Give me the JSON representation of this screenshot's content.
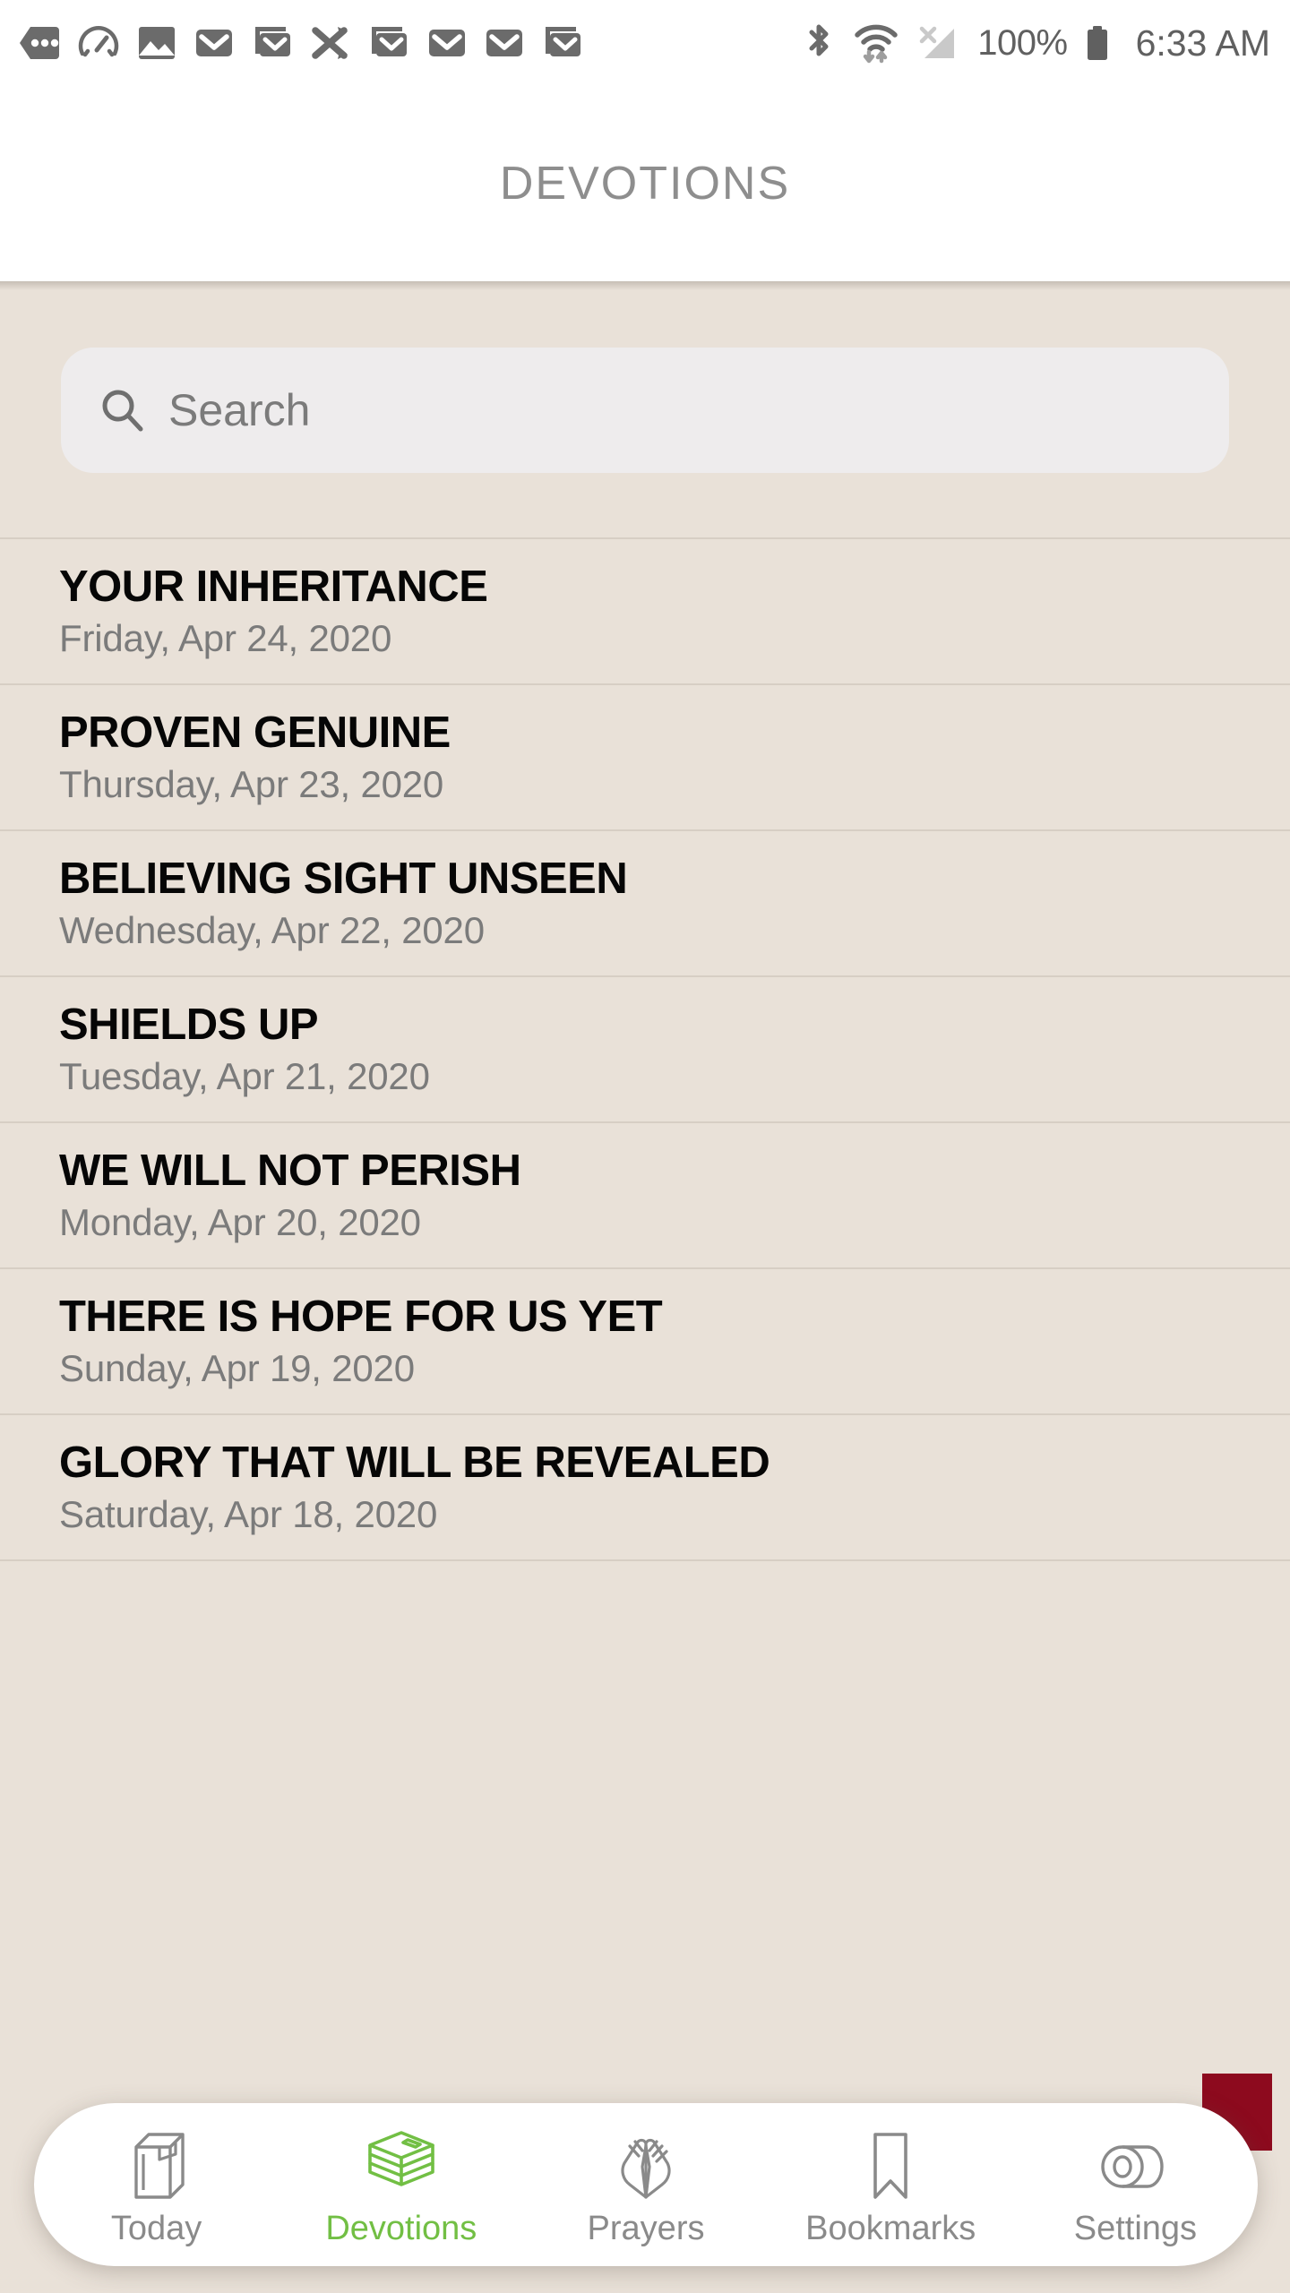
{
  "statusbar": {
    "left_icons": [
      {
        "name": "more-notifications-icon",
        "glyph": "•••"
      },
      {
        "name": "speedometer-icon"
      },
      {
        "name": "image-icon"
      },
      {
        "name": "mail-icon"
      },
      {
        "name": "mail-stack-icon"
      },
      {
        "name": "shuffle-icon"
      },
      {
        "name": "mail-stack-icon"
      },
      {
        "name": "mail-icon"
      },
      {
        "name": "mail-icon"
      },
      {
        "name": "mail-stack-icon"
      }
    ],
    "right_icons": [
      {
        "name": "bluetooth-icon"
      },
      {
        "name": "wifi-icon"
      },
      {
        "name": "cellular-no-signal-icon"
      }
    ],
    "battery_percent": "100%",
    "clock": "6:33 AM"
  },
  "header": {
    "title": "DEVOTIONS"
  },
  "search": {
    "placeholder": "Search",
    "value": ""
  },
  "devotions": [
    {
      "title": "YOUR INHERITANCE",
      "date": "Friday, Apr 24, 2020"
    },
    {
      "title": "PROVEN GENUINE",
      "date": "Thursday, Apr 23, 2020"
    },
    {
      "title": "BELIEVING SIGHT UNSEEN",
      "date": "Wednesday, Apr 22, 2020"
    },
    {
      "title": "SHIELDS UP",
      "date": "Tuesday, Apr 21, 2020"
    },
    {
      "title": "WE WILL NOT PERISH",
      "date": "Monday, Apr 20, 2020"
    },
    {
      "title": "THERE IS HOPE FOR US YET",
      "date": "Sunday, Apr 19, 2020"
    },
    {
      "title": "GLORY THAT WILL BE REVEALED",
      "date": "Saturday, Apr 18, 2020"
    }
  ],
  "bottom_nav": {
    "active_index": 1,
    "items": [
      {
        "label": "Today",
        "icon": "book-icon"
      },
      {
        "label": "Devotions",
        "icon": "book-stack-icon"
      },
      {
        "label": "Prayers",
        "icon": "praying-hands-icon"
      },
      {
        "label": "Bookmarks",
        "icon": "bookmark-icon"
      },
      {
        "label": "Settings",
        "icon": "toggle-switch-icon"
      }
    ]
  },
  "colors": {
    "accent_green": "#72bf44",
    "page_background": "#e9e1d8",
    "divider": "#d7cec4",
    "red_tab": "#8d0a1e",
    "muted_text": "#7b7b7b",
    "title_text": "#060606"
  }
}
